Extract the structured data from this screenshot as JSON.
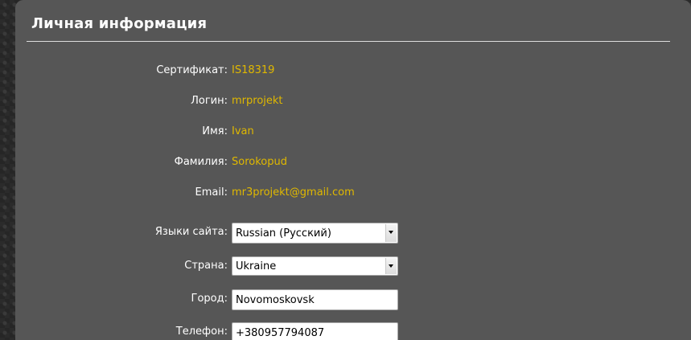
{
  "section": {
    "title": "Личная информация"
  },
  "info": [
    {
      "label": "Сертификат:",
      "value": "IS18319"
    },
    {
      "label": "Логин:",
      "value": "mrprojekt"
    },
    {
      "label": "Имя:",
      "value": "Ivan"
    },
    {
      "label": "Фамилия:",
      "value": "Sorokopud"
    },
    {
      "label": "Email:",
      "value": "mr3projekt@gmail.com"
    }
  ],
  "form": {
    "language": {
      "label": "Языки сайта:",
      "selected": "Russian (Русский)"
    },
    "country": {
      "label": "Страна:",
      "selected": "Ukraine"
    },
    "city": {
      "label": "Город:",
      "value": "Novomoskovsk"
    },
    "phone": {
      "label": "Телефон:",
      "value": "+380957794087"
    }
  },
  "colors": {
    "panel": "#565656",
    "label": "#ffffff",
    "value": "#e0b800"
  }
}
